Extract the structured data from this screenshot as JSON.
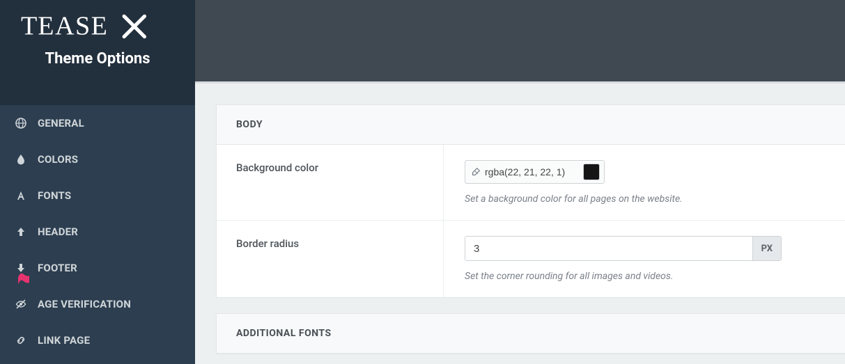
{
  "brand": {
    "svg_text": "TEASEX"
  },
  "subtitle": "Theme Options",
  "sidebar": {
    "items": [
      {
        "label": "GENERAL",
        "icon": "globe-icon"
      },
      {
        "label": "COLORS",
        "icon": "droplet-icon"
      },
      {
        "label": "FONTS",
        "icon": "font-icon"
      },
      {
        "label": "HEADER",
        "icon": "arrow-up-icon"
      },
      {
        "label": "FOOTER",
        "icon": "arrow-down-icon"
      },
      {
        "label": "AGE VERIFICATION",
        "icon": "eye-slash-icon"
      },
      {
        "label": "LINK PAGE",
        "icon": "link-icon"
      }
    ]
  },
  "panel_body": {
    "title": "BODY",
    "rows": {
      "bgcolor": {
        "label": "Background color",
        "value": "rgba(22, 21, 22, 1)",
        "swatch": "#161516",
        "help": "Set a background color for all pages on the website."
      },
      "radius": {
        "label": "Border radius",
        "value": "3",
        "unit": "PX",
        "help": "Set the corner rounding for all images and videos."
      }
    }
  },
  "panel_fonts": {
    "title": "ADDITIONAL FONTS"
  }
}
